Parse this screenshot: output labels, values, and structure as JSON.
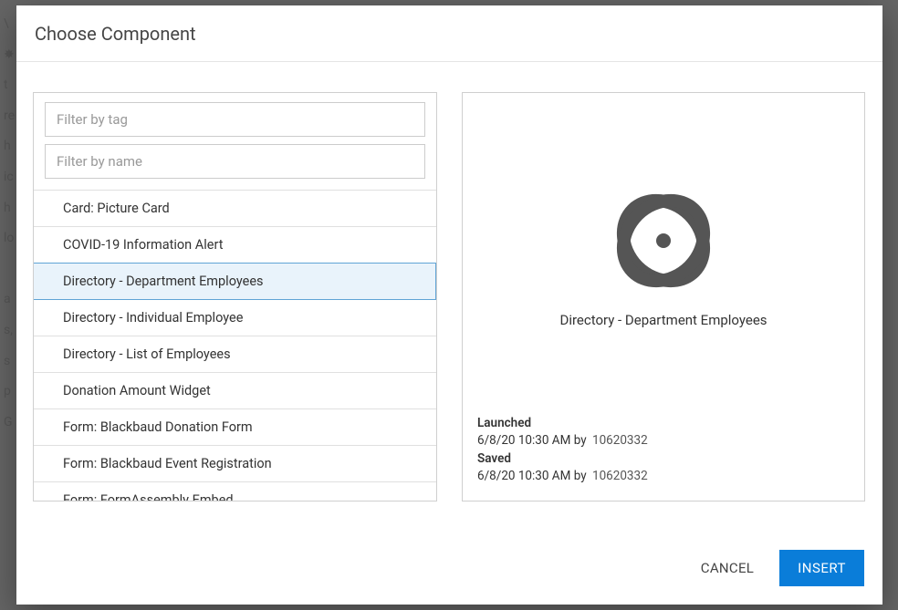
{
  "dialog": {
    "title": "Choose Component",
    "filter_tag_placeholder": "Filter by tag",
    "filter_name_placeholder": "Filter by name"
  },
  "components": {
    "selected_index": 2,
    "items": [
      {
        "label": "Card: Picture Card"
      },
      {
        "label": "COVID-19 Information Alert"
      },
      {
        "label": "Directory - Department Employees"
      },
      {
        "label": "Directory - Individual Employee"
      },
      {
        "label": "Directory - List of Employees"
      },
      {
        "label": "Donation Amount Widget"
      },
      {
        "label": "Form: Blackbaud Donation Form"
      },
      {
        "label": "Form: Blackbaud Event Registration"
      },
      {
        "label": "Form: FormAssembly Embed"
      }
    ]
  },
  "preview": {
    "title": "Directory - Department Employees",
    "icon": "atom-icon",
    "launched_label": "Launched",
    "launched_stamp": "6/8/20 10:30 AM by",
    "launched_user": "10620332",
    "saved_label": "Saved",
    "saved_stamp": "6/8/20 10:30 AM by",
    "saved_user": "10620332"
  },
  "footer": {
    "cancel": "CANCEL",
    "insert": "INSERT"
  }
}
